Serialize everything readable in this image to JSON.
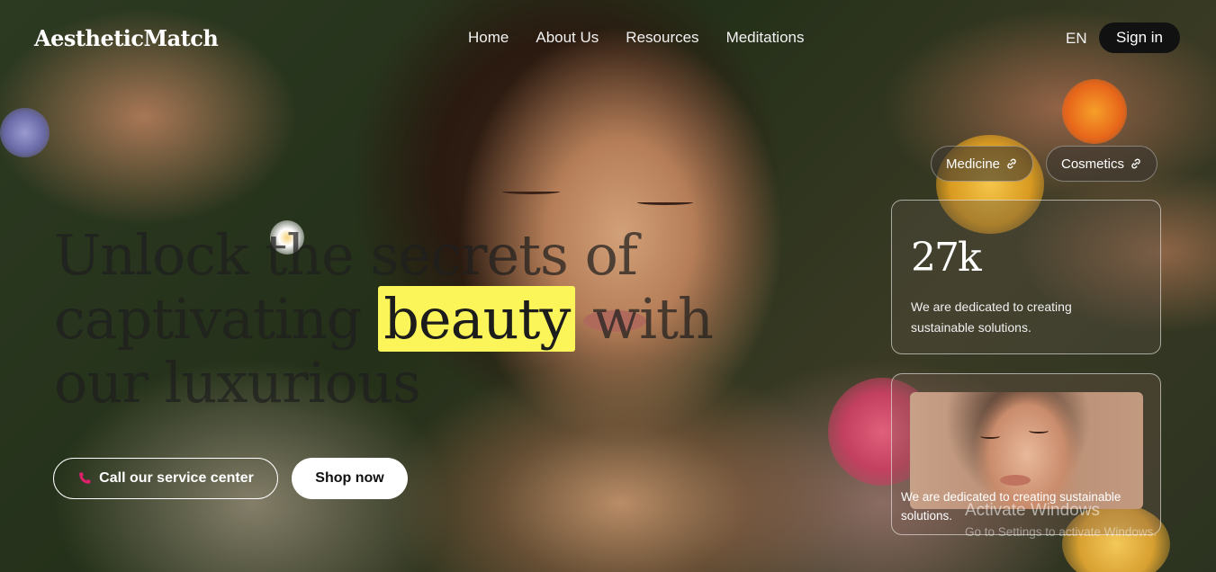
{
  "brand": {
    "logo": "AestheticMatch"
  },
  "nav": {
    "items": [
      {
        "label": "Home"
      },
      {
        "label": "About Us"
      },
      {
        "label": "Resources"
      },
      {
        "label": "Meditations"
      }
    ],
    "language": "EN",
    "signin_label": "Sign in"
  },
  "tags": [
    {
      "label": "Medicine",
      "icon": "link-icon"
    },
    {
      "label": "Cosmetics",
      "icon": "link-icon"
    }
  ],
  "hero": {
    "headline_part1": "Unlock the secrets of captivating",
    "headline_highlight": "beauty",
    "headline_part2": "with our luxurious",
    "highlight_color": "#fbf55a"
  },
  "actions": {
    "call_label": "Call our service center",
    "call_icon": "phone-icon",
    "call_icon_color": "#e0206a",
    "shop_label": "Shop now"
  },
  "stat_card": {
    "value": "27k",
    "description": "We are dedicated to creating sustainable solutions."
  },
  "image_card": {
    "caption": "We are dedicated to creating sustainable solutions."
  },
  "system_overlay": {
    "title": "Activate Windows",
    "subtitle": "Go to Settings to activate Windows."
  }
}
